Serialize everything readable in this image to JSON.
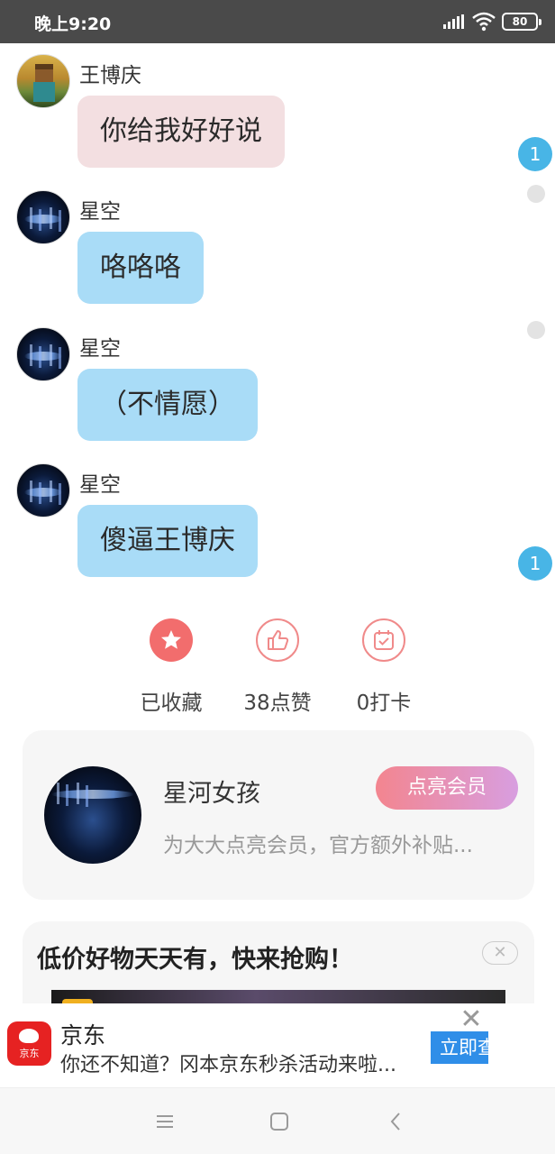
{
  "status_bar": {
    "time": "晚上9:20",
    "battery": "80"
  },
  "messages": [
    {
      "sender": "王博庆",
      "text": "你给我好好说",
      "avatar": "minecraft-avatar",
      "color": "#f3dfe1"
    },
    {
      "sender": "星空",
      "text": "咯咯咯",
      "avatar": "space-avatar",
      "color": "#a9dcf7"
    },
    {
      "sender": "星空",
      "text": "（不情愿）",
      "avatar": "space-avatar",
      "color": "#a9dcf7"
    },
    {
      "sender": "星空",
      "text": "傻逼王博庆",
      "avatar": "space-avatar",
      "color": "#a9dcf7"
    }
  ],
  "side_badges": [
    "1",
    "1"
  ],
  "actions": [
    {
      "icon": "star-icon",
      "label": "已收藏"
    },
    {
      "icon": "thumbs-up-icon",
      "label": "38点赞"
    },
    {
      "icon": "calendar-check-icon",
      "label": "0打卡"
    }
  ],
  "vip_card": {
    "name": "星河女孩",
    "button": "点亮会员",
    "description": "为大大点亮会员，官方额外补贴..."
  },
  "promo": {
    "title": "低价好物天天有，快来抢购！"
  },
  "ad": {
    "logo_text": "京东",
    "brand": "京东",
    "subtitle": "你还不知道？冈本京东秒杀活动来啦...",
    "cta": "立即查"
  },
  "colors": {
    "accent_blue": "#48b5e6",
    "like_red": "#f26d6d",
    "status_bar": "#4a4a4a"
  }
}
